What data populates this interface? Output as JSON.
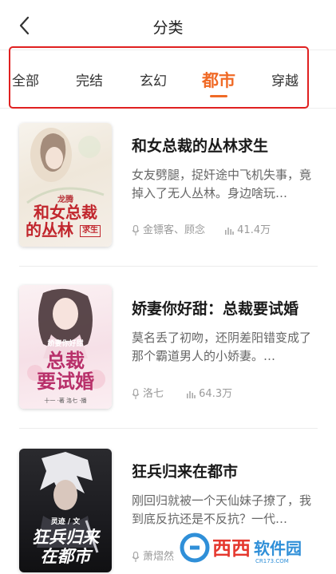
{
  "header": {
    "title": "分类"
  },
  "tabs": [
    {
      "label": "全部"
    },
    {
      "label": "完结"
    },
    {
      "label": "玄幻"
    },
    {
      "label": "都市",
      "active": true
    },
    {
      "label": "穿越"
    }
  ],
  "colors": {
    "accent": "#f06a26",
    "annotation_box": "#e02020"
  },
  "books": [
    {
      "title": "和女总裁的丛林求生",
      "description": "女友劈腿，捉奸途中飞机失事，竟掉入了无人丛林。身边啥玩…",
      "narrators": "金镖客、顾念",
      "plays": "41.4万",
      "cover_text": {
        "line1": "和女总裁",
        "line2": "的丛林",
        "tag": "求生",
        "brand": "龙腾"
      }
    },
    {
      "title": "娇妻你好甜：总裁要试婚",
      "description": "莫名丢了初吻，还阴差阳错变成了那个霸道男人的小娇妻。…",
      "narrators": "洛七",
      "plays": "64.3万",
      "cover_text": {
        "top": "娇妻你好甜",
        "line1": "总裁",
        "line2": "要试婚",
        "footer": "十一 ·著    洛七 ·播"
      }
    },
    {
      "title": "狂兵归来在都市",
      "description": "刚回归就被一个天仙妹子撩了，我到底反抗还是不反抗？一代…",
      "narrators": "萧熠然",
      "plays": "",
      "cover_text": {
        "small": "灵迹 / 文",
        "line1": "狂兵归来",
        "line2": "在都市"
      }
    }
  ],
  "icons": {
    "back": "back-arrow-icon",
    "narrator": "microphone-icon",
    "plays": "bar-chart-icon"
  },
  "watermark": {
    "text": "西西软件园",
    "sub": "CR173.COM"
  }
}
